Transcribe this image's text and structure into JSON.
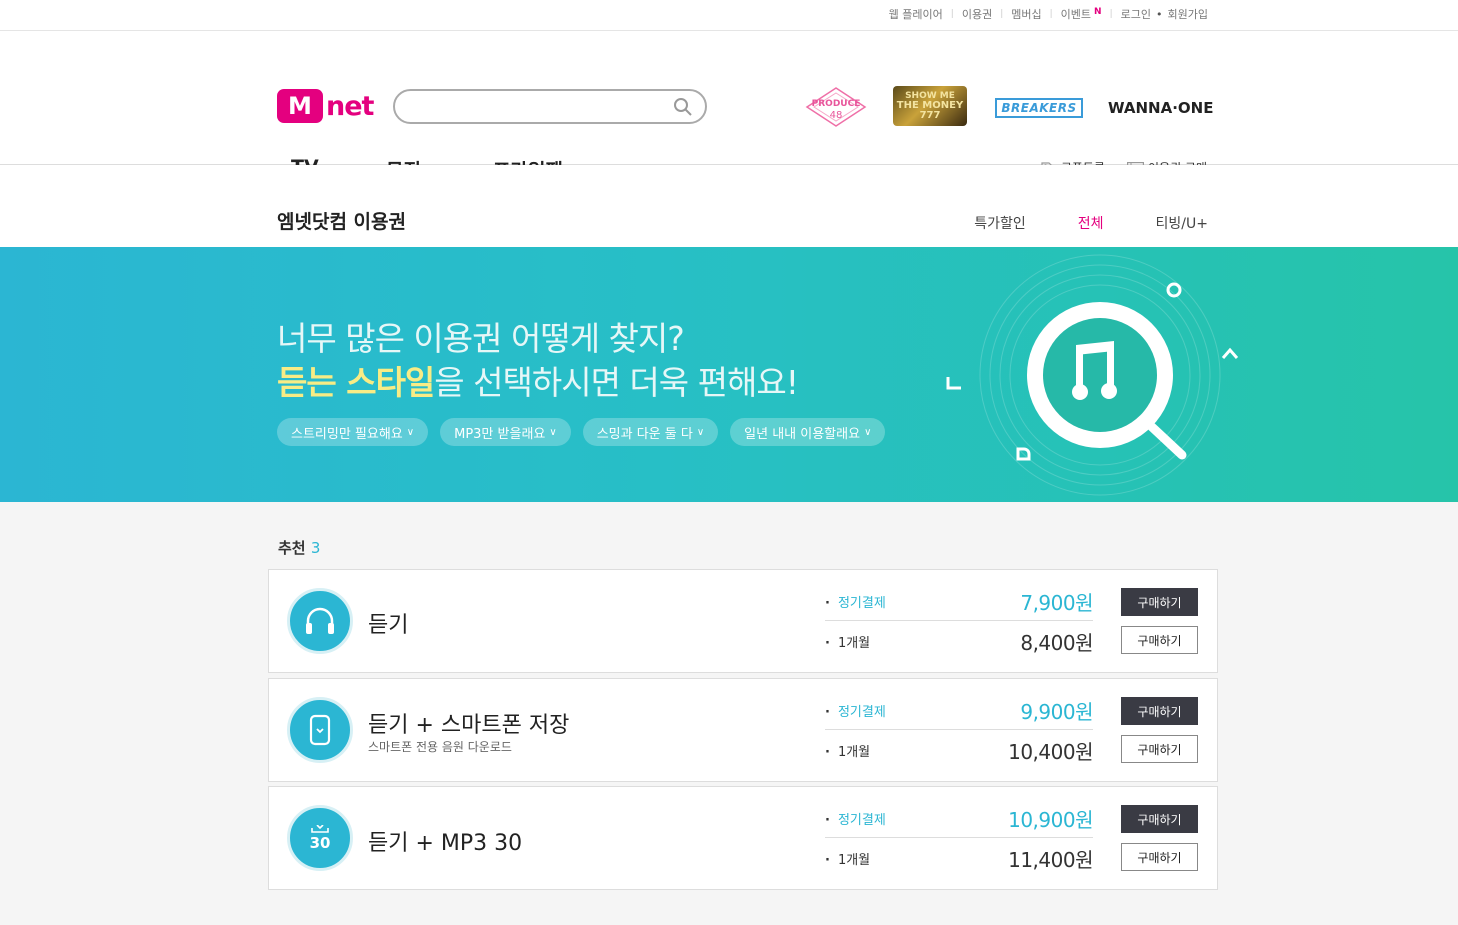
{
  "util_bar": {
    "items": [
      "웹 플레이어",
      "이용권",
      "멤버십",
      "이벤트"
    ],
    "event_badge": "N",
    "login": "로그인",
    "signup": "회원가입"
  },
  "header": {
    "logo_m": "M",
    "logo_net": "net",
    "search_placeholder": "",
    "brands": {
      "produce": "PRODUCE",
      "produce_num": "48",
      "smtm_line1": "SHOW ME",
      "smtm_line2": "THE MONEY",
      "smtm_num": "777",
      "breakers": "BREAKERS",
      "wanna": "WANNA·ONE"
    },
    "nav": {
      "tv": "TV",
      "music": "뮤직",
      "prime": "프라임팩"
    },
    "coupon": "쿠폰등록",
    "purchase": "이용권 구매"
  },
  "subhead": {
    "title": "엠넷닷컴 이용권",
    "tabs": [
      "특가할인",
      "전체",
      "티빙/U+"
    ],
    "active_tab": "전체"
  },
  "banner": {
    "line1": "너무 많은 이용권 어떻게 찾지?",
    "line2_hl": "듣는 스타일",
    "line2_rest": "을 선택하시면 더욱 편해요!",
    "chips": [
      "스트리밍만 필요해요",
      "MP3만 받을래요",
      "스밍과 다운 둘 다",
      "일년 내내 이용할래요"
    ]
  },
  "list": {
    "section_label": "추천",
    "count": "3",
    "buy_label": "구매하기",
    "cards": [
      {
        "title": "듣기",
        "subtitle": "",
        "icon": "headphones-icon",
        "plans": [
          {
            "label": "정기결제",
            "price": "7,900원"
          },
          {
            "label": "1개월",
            "price": "8,400원"
          }
        ]
      },
      {
        "title": "듣기 + 스마트폰 저장",
        "subtitle": "스마트폰 전용 음원 다운로드",
        "icon": "smartphone-download-icon",
        "plans": [
          {
            "label": "정기결제",
            "price": "9,900원"
          },
          {
            "label": "1개월",
            "price": "10,400원"
          }
        ]
      },
      {
        "title": "듣기 + MP3 30",
        "subtitle": "",
        "icon": "mp3-download-icon",
        "icon_text": "30",
        "plans": [
          {
            "label": "정기결제",
            "price": "10,900원"
          },
          {
            "label": "1개월",
            "price": "11,400원"
          }
        ]
      }
    ]
  },
  "colors": {
    "brand_pink": "#e4007f",
    "accent_teal": "#2bb6d3",
    "banner_highlight": "#f8ec85",
    "button_dark": "#3a3b44"
  }
}
